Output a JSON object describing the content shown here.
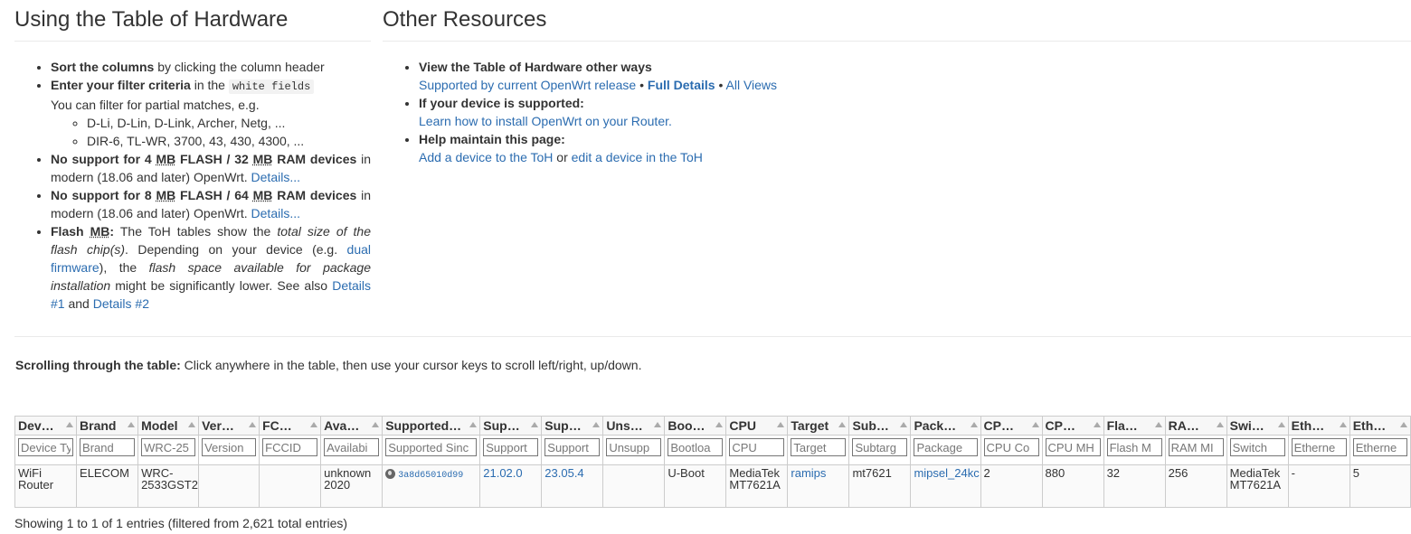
{
  "left": {
    "title": "Using the Table of Hardware",
    "sort": {
      "bold": "Sort the columns",
      "rest": " by clicking the column header"
    },
    "filter": {
      "bold": "Enter your filter criteria",
      "rest": " in the ",
      "code": "white fields",
      "partial": "You can filter for partial matches, e.g.",
      "examples": [
        "D-Li, D-Lin, D-Link, Archer, Netg, ...",
        "DIR-6, TL-WR, 3700, 43, 430, 4300, ..."
      ]
    },
    "nosupport4": {
      "b1": "No support for 4 ",
      "mb1": "MB",
      "b2": " FLASH / 32 ",
      "mb2": "MB",
      "b3": " RAM devices",
      "rest": " in modern (18.06 and later) OpenWrt. ",
      "link": "Details..."
    },
    "nosupport8": {
      "b1": "No support for 8 ",
      "mb1": "MB",
      "b2": " FLASH / 64 ",
      "mb2": "MB",
      "b3": " RAM devices",
      "rest": " in modern (18.06 and later) OpenWrt. ",
      "link": "Details..."
    },
    "flash": {
      "b1": "Flash ",
      "mb": "MB",
      "b2": ":",
      "t1": " The ToH tables show the ",
      "i1": "total size of the flash chip(s)",
      "t2": ". Depending on your device (e.g. ",
      "link_dual": "dual firmware",
      "t3": "), the ",
      "i2": "flash space available for package installation",
      "t4": " might be significantly lower. See also ",
      "link_d1": "Details #1",
      "t5": " and ",
      "link_d2": "Details #2"
    }
  },
  "right": {
    "title": "Other Resources",
    "view": {
      "bold": "View the Table of Hardware other ways",
      "link1": "Supported by current OpenWrt release",
      "sep": " • ",
      "link2": "Full Details",
      "link3": "All Views"
    },
    "supported": {
      "bold": "If your device is supported:",
      "link": "Learn how to install OpenWrt on your Router."
    },
    "help": {
      "bold": "Help maintain this page:",
      "link1": "Add a device to the ToH",
      "or": " or ",
      "link2": "edit a device in the ToH"
    }
  },
  "scroll_note": {
    "bold": "Scrolling through the table:",
    "rest": " Click anywhere in the table, then use your cursor keys to scroll left/right, up/down."
  },
  "table": {
    "headers": [
      "Dev…",
      "Brand",
      "Model",
      "Ver…",
      "FC…",
      "Ava…",
      "Supported…",
      "Sup…",
      "Sup…",
      "Uns…",
      "Boo…",
      "CPU",
      "Target",
      "Sub…",
      "Pack…",
      "CP…",
      "CP…",
      "Fla…",
      "RA…",
      "Swi…",
      "Eth…",
      "Eth…"
    ],
    "filters": [
      "Device Ty",
      "Brand",
      "WRC-25",
      "Version",
      "FCCID",
      "Availabi",
      "Supported Sinc",
      "Support",
      "Support",
      "Unsupp",
      "Bootloa",
      "CPU",
      "Target",
      "Subtarg",
      "Package",
      "CPU Co",
      "CPU MH",
      "Flash M",
      "RAM MI",
      "Switch",
      "Etherne",
      "Etherne"
    ],
    "row": {
      "device_type": "WiFi Router",
      "brand": "ELECOM",
      "model": "WRC-2533GST2",
      "version": "",
      "fccid": "",
      "availability": "unknown 2020",
      "supported_since_commit": "3a8d65010d99",
      "supported_since_rel": "21.02.0",
      "supported_current_rel": "23.05.4",
      "unsupported": "",
      "bootloader": "U-Boot",
      "cpu": "MediaTek MT7621A",
      "target": "ramips",
      "subtarget": "mt7621",
      "package_arch": "mipsel_24kc",
      "cpu_cores": "2",
      "cpu_mhz": "880",
      "flash_mb": "32",
      "ram_mb": "256",
      "switch": "MediaTek MT7621A",
      "eth100": "-",
      "eth1g": "5"
    }
  },
  "showing": "Showing 1 to 1 of 1 entries (filtered from 2,621 total entries)",
  "colors": {
    "link": "#2b6cb0",
    "text": "#333333",
    "border": "#cccccc"
  }
}
